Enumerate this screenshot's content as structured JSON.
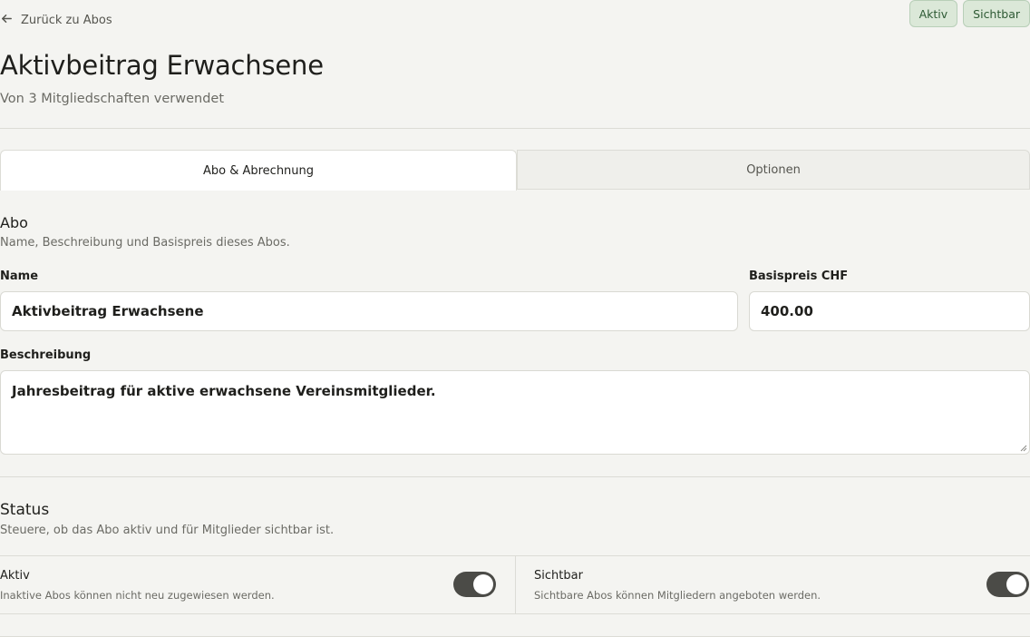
{
  "header": {
    "back_label": "Zurück zu Abos",
    "title": "Aktivbeitrag Erwachsene",
    "subtitle": "Von 3 Mitgliedschaften verwendet",
    "badges": [
      "Aktiv",
      "Sichtbar"
    ]
  },
  "tabs": [
    {
      "label": "Abo & Abrechnung",
      "active": true
    },
    {
      "label": "Optionen",
      "active": false
    }
  ],
  "abo_section": {
    "title": "Abo",
    "description": "Name, Beschreibung und Basispreis dieses Abos.",
    "name_label": "Name",
    "name_value": "Aktivbeitrag Erwachsene",
    "price_label": "Basispreis CHF",
    "price_value": "400.00",
    "description_label": "Beschreibung",
    "description_value": "Jahresbeitrag für aktive erwachsene Vereinsmitglieder."
  },
  "status_section": {
    "title": "Status",
    "description": "Steuere, ob das Abo aktiv und für Mitglieder sichtbar ist.",
    "active_label": "Aktiv",
    "active_help": "Inaktive Abos können nicht neu zugewiesen werden.",
    "active_on": true,
    "visible_label": "Sichtbar",
    "visible_help": "Sichtbare Abos können Mitgliedern angeboten werden.",
    "visible_on": true
  },
  "icons": {
    "back": "arrow-left-icon"
  },
  "colors": {
    "background": "#f4f4f1",
    "badge_bg": "#dbe8d8",
    "badge_text": "#2e5a34",
    "toggle_on": "#4b4b47"
  }
}
